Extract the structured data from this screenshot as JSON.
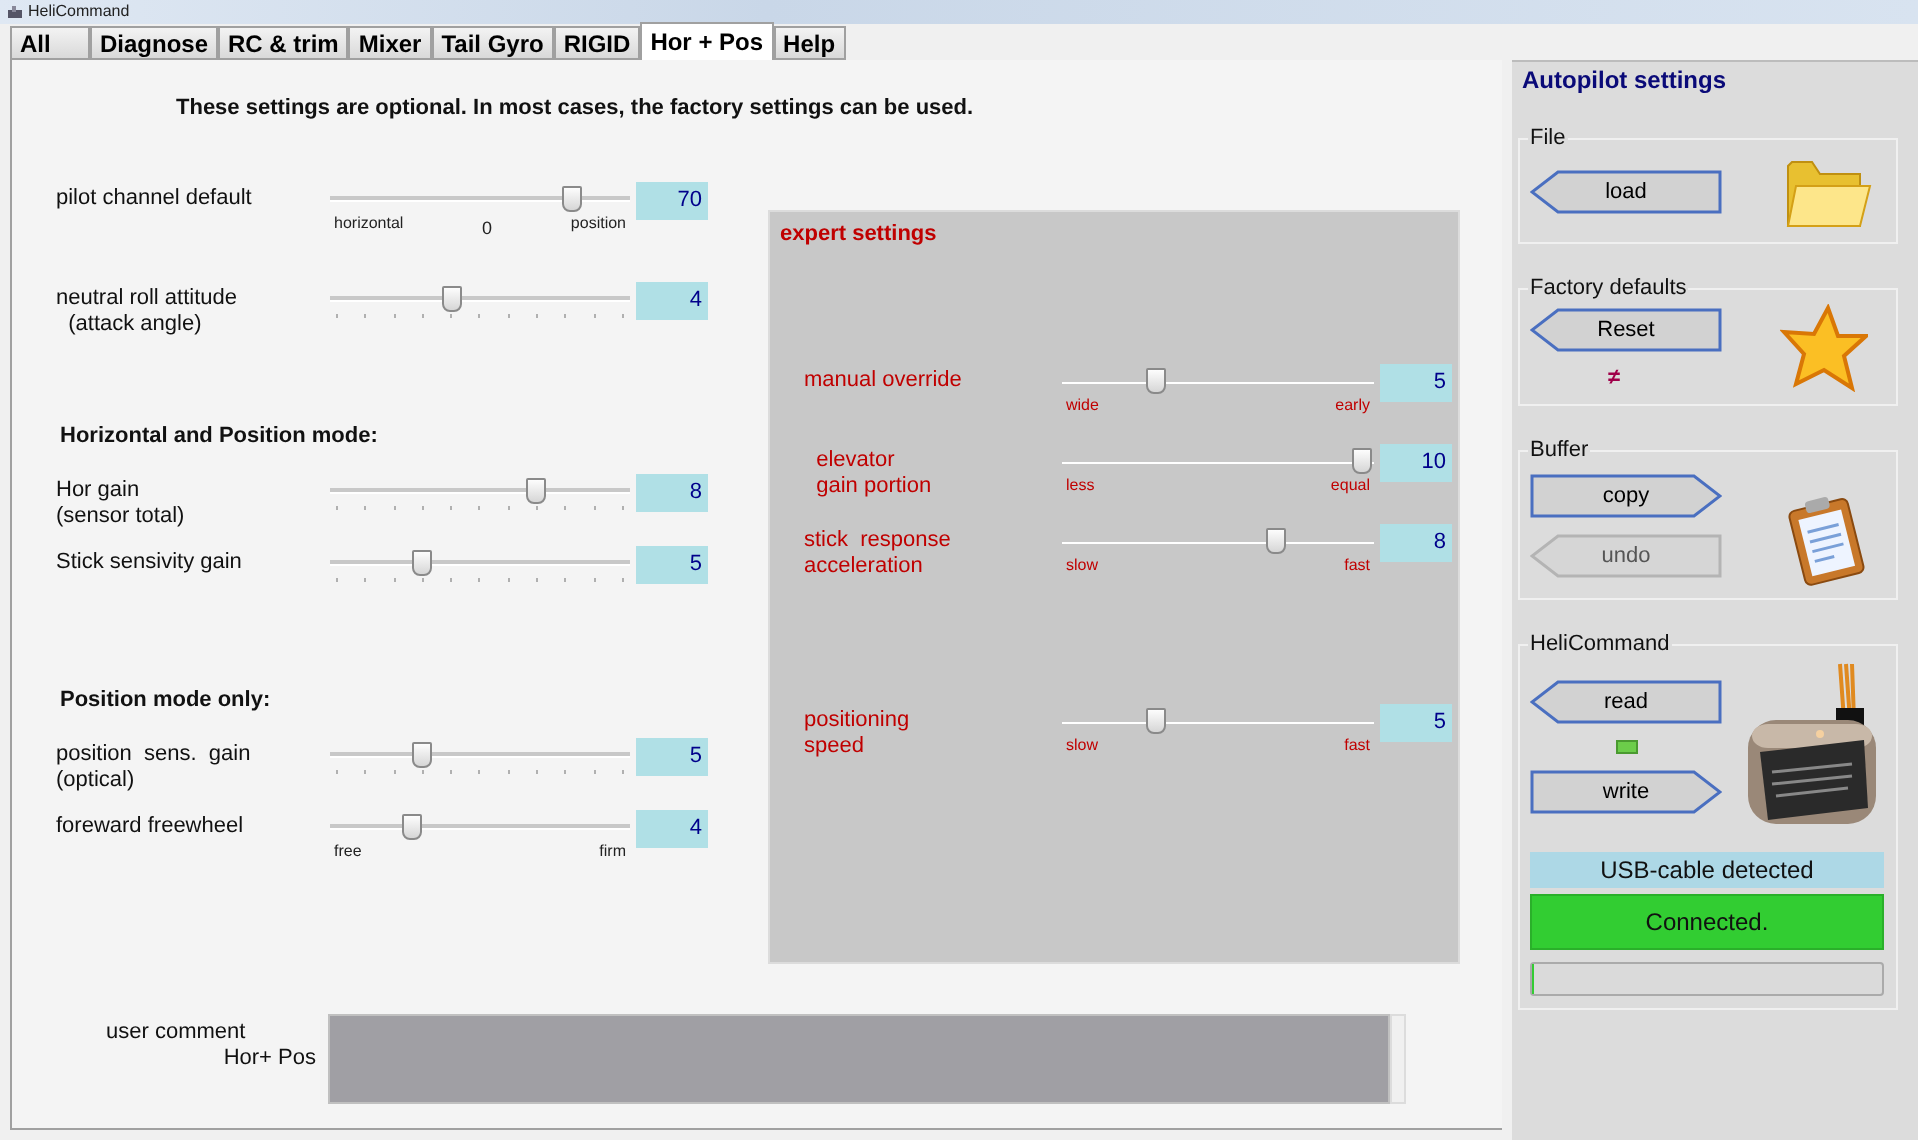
{
  "window": {
    "title": "HeliCommand"
  },
  "tabs": [
    {
      "label": "All",
      "selected": false
    },
    {
      "label": "Diagnose",
      "selected": false
    },
    {
      "label": "RC & trim",
      "selected": false
    },
    {
      "label": "Mixer",
      "selected": false
    },
    {
      "label": "Tail Gyro",
      "selected": false
    },
    {
      "label": "RIGID",
      "selected": false
    },
    {
      "label": "Hor + Pos",
      "selected": true
    },
    {
      "label": "Help",
      "selected": false
    }
  ],
  "intro": "These settings are optional. In most cases, the factory settings can be used.",
  "settings": [
    {
      "kind": "slider",
      "label": "pilot channel default",
      "level": 0.83,
      "value": "70",
      "scale": [
        "horizontal",
        "0",
        "position"
      ]
    },
    {
      "kind": "slider",
      "label": "neutral roll attitude\n  (attack angle)",
      "level": 0.4,
      "value": "4"
    },
    {
      "kind": "heading",
      "label": "Horizontal  and  Position mode:"
    },
    {
      "kind": "slider",
      "label": "Hor gain\n(sensor total)",
      "level": 0.7,
      "value": "8"
    },
    {
      "kind": "slider",
      "label": "Stick sensivity gain",
      "level": 0.29,
      "value": "5"
    },
    {
      "kind": "heading",
      "label": "Position mode  only:"
    },
    {
      "kind": "slider",
      "label": "position  sens.  gain\n(optical)",
      "level": 0.29,
      "value": "5"
    },
    {
      "kind": "slider",
      "label": "foreward freewheel",
      "level": 0.26,
      "value": "4",
      "scale": [
        "free",
        "firm"
      ]
    }
  ],
  "expert": {
    "title": "expert settings",
    "rows": [
      {
        "label": "manual override",
        "level": 0.29,
        "value": "5",
        "scale": [
          "wide",
          "early"
        ]
      },
      {
        "label": "  elevator\n  gain portion",
        "level": 0.99,
        "value": "10",
        "scale": [
          "less",
          "equal"
        ]
      },
      {
        "label": "stick  response\nacceleration",
        "level": 0.7,
        "value": "8",
        "scale": [
          "slow",
          "fast"
        ]
      },
      {
        "label": "positioning\nspeed",
        "level": 0.29,
        "value": "5",
        "scale": [
          "slow",
          "fast"
        ]
      }
    ]
  },
  "comment": {
    "label": "user comment",
    "sublabel": "Hor+ Pos"
  },
  "autopilot": {
    "title": "Autopilot settings",
    "groups": [
      {
        "title": "File",
        "kind": "file",
        "items": [
          {
            "kind": "back",
            "label": "load",
            "disabled": false
          }
        ]
      },
      {
        "title": "Factory defaults",
        "kind": "defaults",
        "items": [
          {
            "kind": "back",
            "label": "Reset",
            "disabled": false
          },
          {
            "kind": "glyph",
            "label": "≠"
          }
        ]
      },
      {
        "title": "Buffer",
        "kind": "buffer",
        "items": [
          {
            "kind": "forward",
            "label": "copy",
            "disabled": false
          },
          {
            "kind": "back",
            "label": "undo",
            "disabled": true
          }
        ]
      },
      {
        "title": "HeliCommand",
        "kind": "device",
        "items": [
          {
            "kind": "back",
            "label": "read",
            "disabled": false
          },
          {
            "kind": "led"
          },
          {
            "kind": "forward",
            "label": "write",
            "disabled": false
          }
        ],
        "status": "USB-cable detected",
        "connection": "Connected.",
        "progress": {
          "level": 0
        }
      }
    ]
  }
}
